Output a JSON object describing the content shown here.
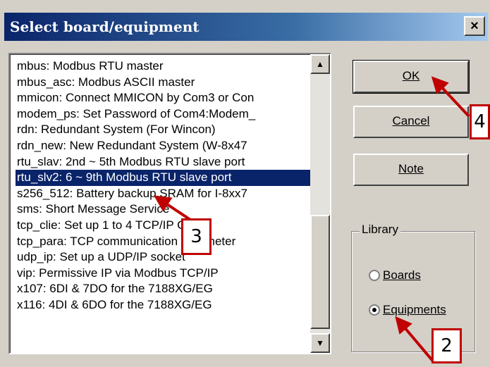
{
  "window": {
    "title": "Select board/equipment",
    "close_label": "×"
  },
  "list": {
    "items": [
      "mbus: Modbus RTU master",
      "mbus_asc: Modbus ASCII master",
      "mmicon: Connect MMICON by Com3 or Con",
      "modem_ps: Set Password of Com4:Modem_",
      "rdn: Redundant System (For Wincon)",
      "rdn_new: New Redundant System (W-8x47",
      "rtu_slav: 2nd ~ 5th Modbus RTU slave port",
      "rtu_slv2: 6 ~ 9th Modbus RTU slave port",
      "s256_512: Battery backup SRAM for I-8xx7",
      "sms: Short Message Service",
      "tcp_clie: Set up 1 to 4 TCP/IP Client",
      "tcp_para: TCP communication parameter",
      "udp_ip: Set up a UDP/IP socket",
      "vip: Permissive IP via Modbus TCP/IP",
      "x107: 6DI & 7DO for the 7188XG/EG",
      "x116: 4DI & 6DO for the 7188XG/EG"
    ],
    "selected_index": 7,
    "scroll_up": "▲",
    "scroll_down": "▼"
  },
  "buttons": {
    "ok": "OK",
    "cancel": "Cancel",
    "note": "Note"
  },
  "library": {
    "label": "Library",
    "options": [
      {
        "label": "Boards",
        "checked": false
      },
      {
        "label": "Equipments",
        "checked": true
      }
    ]
  },
  "callouts": {
    "step2": "2",
    "step3": "3",
    "step4": "4"
  },
  "colors": {
    "annotation": "#c00000",
    "selection": "#0a246a"
  }
}
